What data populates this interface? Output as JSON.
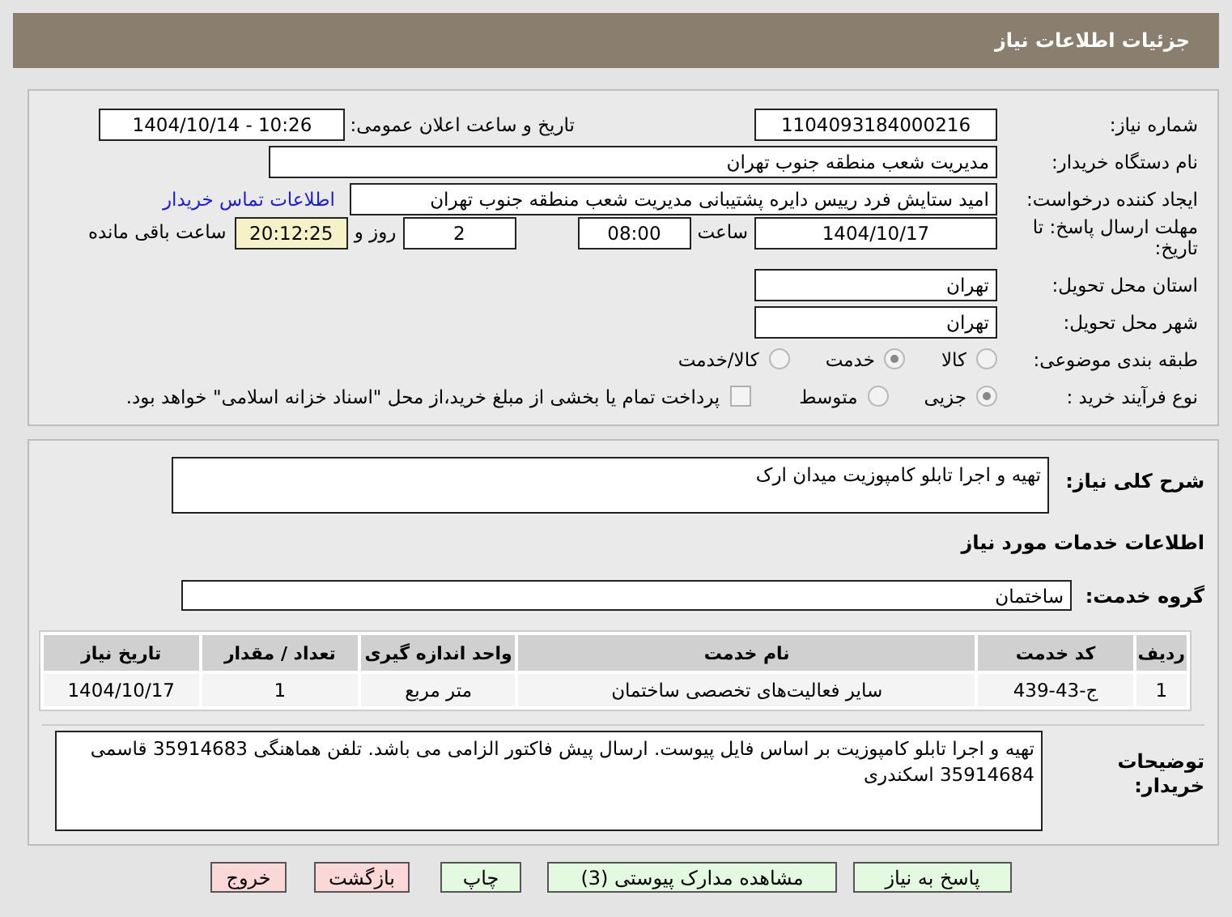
{
  "header": {
    "title": "جزئیات اطلاعات نیاز"
  },
  "info": {
    "need_number": {
      "label": "شماره نیاز:",
      "value": "1104093184000216"
    },
    "announce": {
      "label": "تاریخ و ساعت اعلان عمومی:",
      "value": "1404/10/14 - 10:26"
    },
    "buyer_org": {
      "label": "نام دستگاه خریدار:",
      "value": "مدیریت شعب منطقه جنوب تهران"
    },
    "requester": {
      "label": "ایجاد کننده درخواست:",
      "value": "امید ستایش فرد رییس دایره پشتیبانی مدیریت شعب منطقه جنوب تهران",
      "link": "اطلاعات تماس خریدار"
    },
    "deadline": {
      "label": "مهلت ارسال پاسخ: تا تاریخ:",
      "date": "1404/10/17",
      "time_label": "ساعت",
      "time": "08:00",
      "days": "2",
      "days_label": "روز و",
      "remaining": "20:12:25",
      "remaining_label": "ساعت باقی مانده"
    },
    "province": {
      "label": "استان محل تحویل:",
      "value": "تهران"
    },
    "city": {
      "label": "شهر محل تحویل:",
      "value": "تهران"
    },
    "category": {
      "label": "طبقه بندی موضوعی:",
      "options": [
        {
          "label": "کالا",
          "selected": false
        },
        {
          "label": "خدمت",
          "selected": true
        },
        {
          "label": "کالا/خدمت",
          "selected": false
        }
      ]
    },
    "process": {
      "label": "نوع فرآیند خرید :",
      "options": [
        {
          "label": "جزیی",
          "selected": true
        },
        {
          "label": "متوسط",
          "selected": false
        }
      ],
      "payment": {
        "label": "پرداخت تمام یا بخشی از مبلغ خرید،از محل \"اسناد خزانه اسلامی\" خواهد بود.",
        "checked": false
      }
    }
  },
  "services": {
    "description": {
      "label": "شرح کلی نیاز:",
      "value": "تهیه و اجرا تابلو کامپوزیت میدان ارک"
    },
    "section_title": "اطلاعات خدمات مورد نیاز",
    "group": {
      "label": "گروه خدمت:",
      "value": "ساختمان"
    },
    "table": {
      "columns": [
        "ردیف",
        "کد خدمت",
        "نام خدمت",
        "واحد اندازه گیری",
        "تعداد / مقدار",
        "تاریخ نیاز"
      ],
      "rows": [
        [
          "1",
          "ج-43-439",
          "سایر فعالیت‌های تخصصی ساختمان",
          "متر مربع",
          "1",
          "1404/10/17"
        ]
      ]
    },
    "notes": {
      "label": "توضیحات خریدار:",
      "value": "تهیه و اجرا تابلو کامپوزیت بر اساس فایل پیوست. ارسال پیش فاکتور الزامی می باشد. تلفن هماهنگی 35914683 قاسمی 35914684 اسکندری"
    }
  },
  "buttons": [
    {
      "label": "پاسخ به نیاز",
      "kind": "confirm"
    },
    {
      "label": "مشاهده مدارک پیوستی (3)",
      "kind": "confirm"
    },
    {
      "label": "چاپ",
      "kind": "confirm"
    },
    {
      "label": "بازگشت",
      "kind": "cancel"
    },
    {
      "label": "خروج",
      "kind": "cancel"
    }
  ]
}
